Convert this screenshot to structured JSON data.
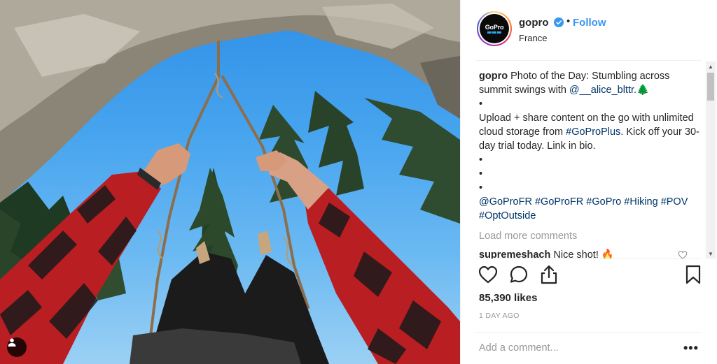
{
  "post": {
    "username": "gopro",
    "verified": true,
    "separator": "•",
    "follow_label": "Follow",
    "location": "France",
    "avatar_logo_text": "GoPro"
  },
  "caption": {
    "username": "gopro",
    "text_1": "Photo of the Day: Stumbling across summit swings with ",
    "mention": "@__alice_blttr.",
    "emoji": "🌲",
    "bullet": "•",
    "text_2": "Upload + share content on the go with unlimited cloud storage from ",
    "hashtag_plus": "#GoProPlus",
    "text_3": ". Kick off your 30-day trial today. Link in bio.",
    "hashtags": "@GoProFR #GoProFR #GoPro #Hiking #POV #OptOutside"
  },
  "comments": {
    "load_more": "Load more comments",
    "items": [
      {
        "username": "supremeshach",
        "text": "Nice shot! 🔥"
      }
    ]
  },
  "actions": {
    "like_icon": "heart-icon",
    "comment_icon": "comment-icon",
    "share_icon": "share-icon",
    "save_icon": "bookmark-icon"
  },
  "likes_text": "85,390 likes",
  "date_text": "1 DAY AGO",
  "comment_input": {
    "placeholder": "Add a comment...",
    "more_label": "•••"
  },
  "colors": {
    "follow": "#3897f0",
    "link": "#003569",
    "muted": "#999999",
    "sky": "#3a9bec"
  }
}
